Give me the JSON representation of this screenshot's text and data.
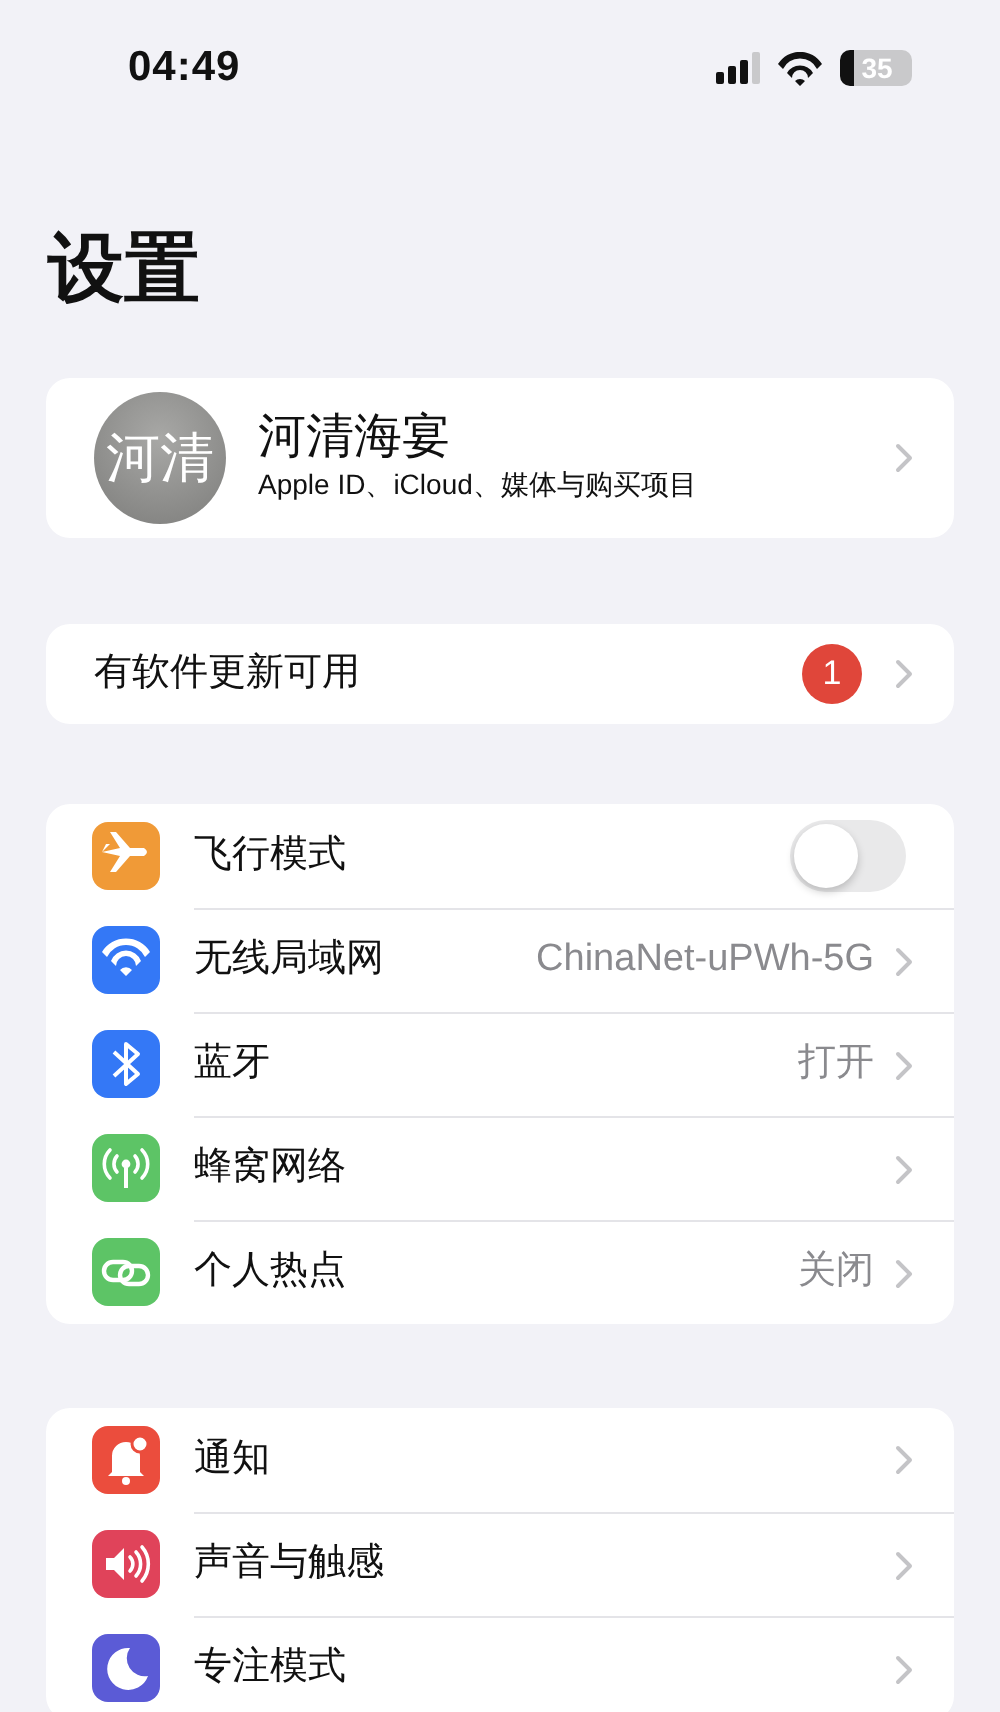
{
  "status_bar": {
    "time": "04:49",
    "battery": "35"
  },
  "title": "设置",
  "profile": {
    "avatar_text": "河清",
    "name": "河清海宴",
    "subtitle": "Apple ID、iCloud、媒体与购买项目"
  },
  "update": {
    "label": "有软件更新可用",
    "badge": "1"
  },
  "groups": [
    {
      "rows": [
        {
          "kind": "toggle",
          "color": "#f09a37",
          "label": "飞行模式",
          "on": false
        },
        {
          "kind": "link",
          "color": "#3478f6",
          "label": "无线局域网",
          "value": "ChinaNet-uPWh-5G"
        },
        {
          "kind": "link",
          "color": "#3478f6",
          "label": "蓝牙",
          "value": "打开"
        },
        {
          "kind": "link",
          "color": "#5dc466",
          "label": "蜂窝网络"
        },
        {
          "kind": "link",
          "color": "#5dc466",
          "label": "个人热点",
          "value": "关闭"
        }
      ]
    },
    {
      "rows": [
        {
          "kind": "link",
          "color": "#eb4d3d",
          "label": "通知"
        },
        {
          "kind": "link",
          "color": "#e0435a",
          "label": "声音与触感"
        },
        {
          "kind": "link",
          "color": "#5b5bd6",
          "label": "专注模式"
        }
      ]
    }
  ]
}
